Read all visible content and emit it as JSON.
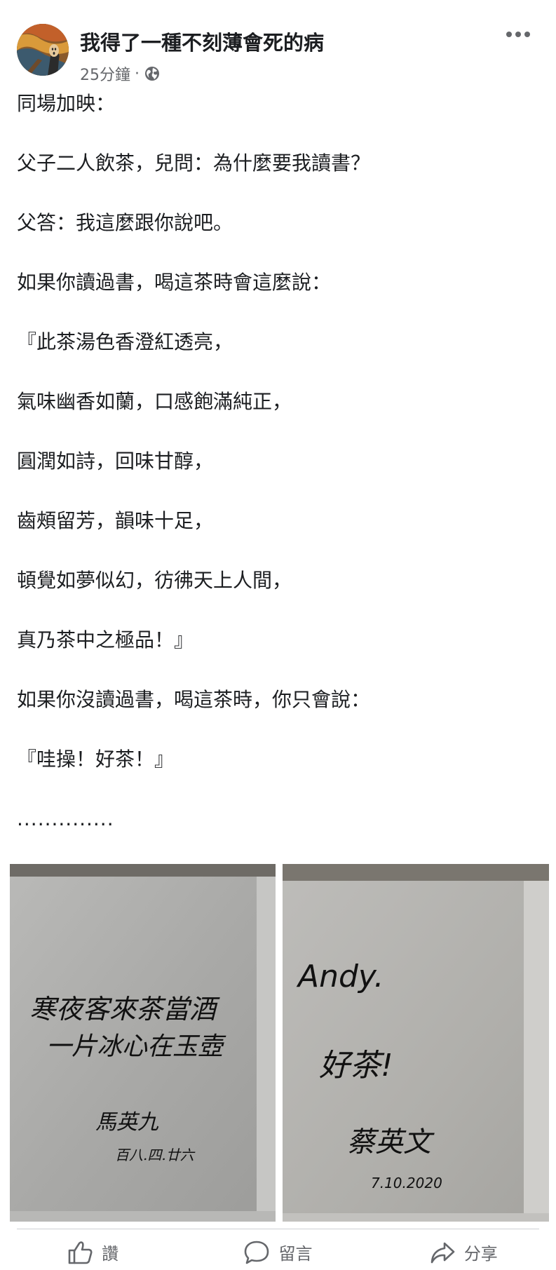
{
  "header": {
    "author": "我得了一種不刻薄會死的病",
    "timestamp": "25分鐘",
    "separator": "·",
    "audience_icon": "globe-icon",
    "more_icon": "more-dots-icon"
  },
  "post": {
    "lines": [
      "同場加映：",
      "父子二人飲茶，兒問：為什麼要我讀書？",
      "父答：我這麼跟你說吧。",
      "如果你讀過書，喝這茶時會這麼說：",
      "『此茶湯色香澄紅透亮，",
      "氣味幽香如蘭，口感飽滿純正，",
      "圓潤如詩，回味甘醇，",
      "齒頰留芳，韻味十足，",
      "頓覺如夢似幻，彷彿天上人間，",
      "真乃茶中之極品！』",
      "如果你沒讀過書，喝這茶時，你只會說：",
      "『哇操！好茶！』",
      ".............."
    ]
  },
  "photos": {
    "left": {
      "line1": "寒夜客來茶當酒",
      "line2": "一片冰心在玉壺",
      "signature": "馬英九",
      "date": "百八.四.廿六"
    },
    "right": {
      "greeting": "Andy.",
      "message": "好茶!",
      "signature": "蔡英文",
      "date": "7.10.2020"
    }
  },
  "actions": {
    "like_label": "讚",
    "comment_label": "留言",
    "share_label": "分享",
    "like_icon": "thumbs-up-icon",
    "comment_icon": "comment-bubble-icon",
    "share_icon": "share-arrow-icon"
  }
}
